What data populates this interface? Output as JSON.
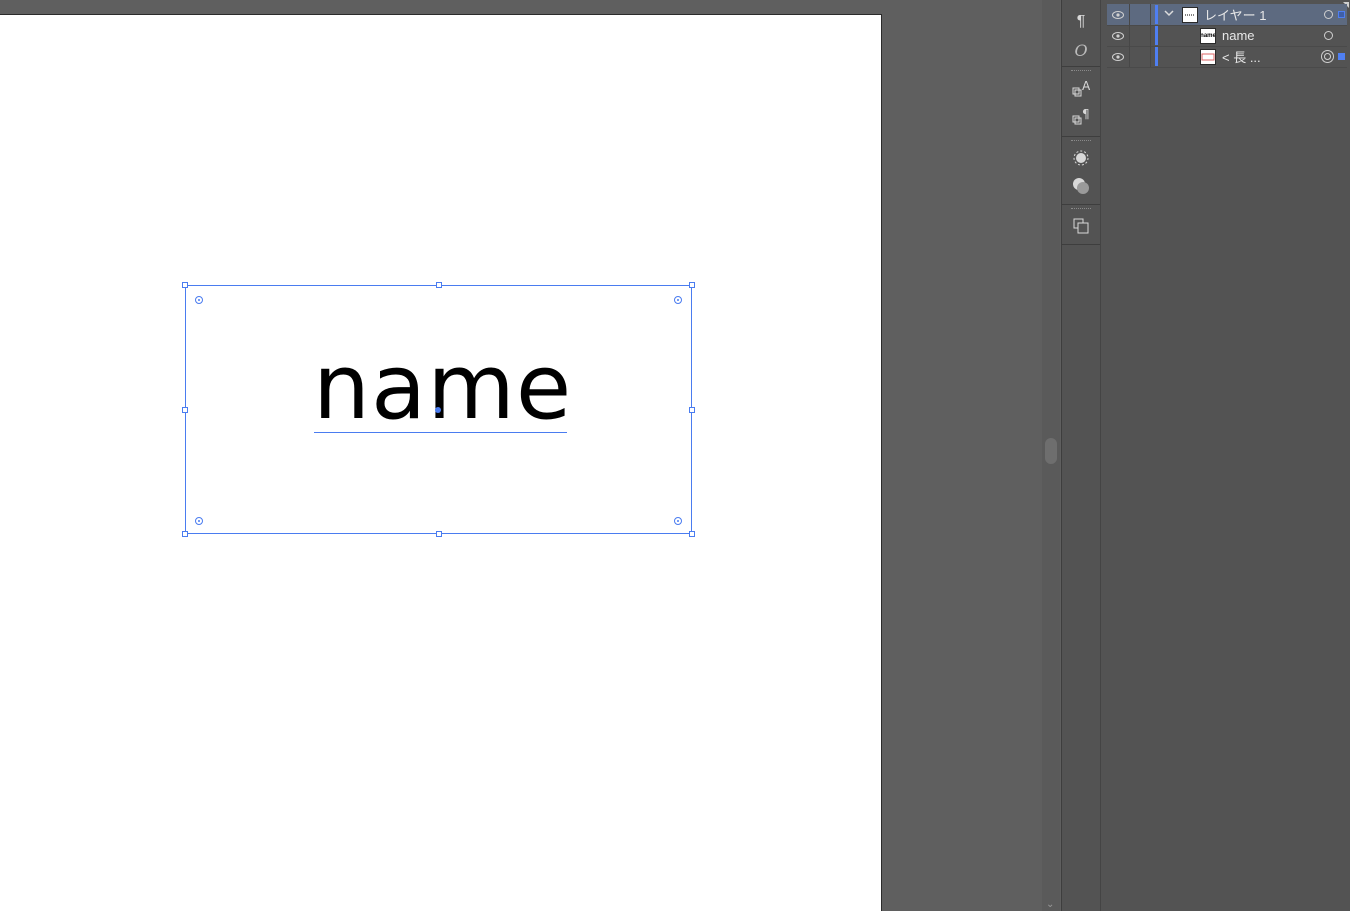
{
  "document": {
    "text_object": "name"
  },
  "layers_panel": {
    "rows": [
      {
        "label": "レイヤー 1",
        "thumb_text": "",
        "expanded": true
      },
      {
        "label": "name",
        "thumb_text": "name"
      },
      {
        "label": "< 長 ...",
        "thumb_text": ""
      }
    ]
  },
  "icons": {
    "strip": [
      "paragraph-icon",
      "opentype-icon",
      "character-styles-icon",
      "paragraph-styles-icon",
      "appearance-icon",
      "transparency-icon",
      "pathfinder-icon"
    ],
    "paragraph_glyph": "¶",
    "opentype_glyph": "O",
    "char_style_glyph": "A",
    "scroll_down_glyph": "⌄",
    "eye_glyph": "👁",
    "chevron_glyph": "⌄"
  },
  "colors": {
    "selection": "#4a7cf0",
    "layer_color": "#4f7ff2",
    "panel_bg": "#535353",
    "workspace_bg": "#5f5f5f"
  }
}
